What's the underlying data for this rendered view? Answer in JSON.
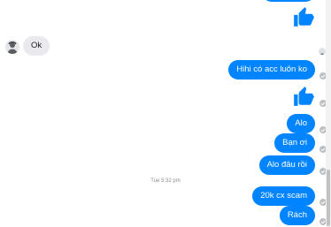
{
  "conversation": {
    "incoming": [
      {
        "text": "Ok"
      }
    ],
    "outgoing": [
      {
        "text": "Hihi có acc luôn ko"
      },
      {
        "text": "Alo"
      },
      {
        "text": "Bạn ơi"
      },
      {
        "text": "Alo đâu rồi"
      },
      {
        "text": "20k cx scam"
      },
      {
        "text": "Rách"
      }
    ],
    "timestamp": "Tue 5:32 pm"
  },
  "colors": {
    "outgoing_bubble": "#0084ff",
    "incoming_bubble": "#e9e9ee",
    "like_icon": "#0084ff",
    "read_receipt": "#bcc0c4"
  },
  "icons": {
    "like": "thumbs-up-icon",
    "read_receipt": "check-circle-icon",
    "avatar": "contact-avatar"
  }
}
